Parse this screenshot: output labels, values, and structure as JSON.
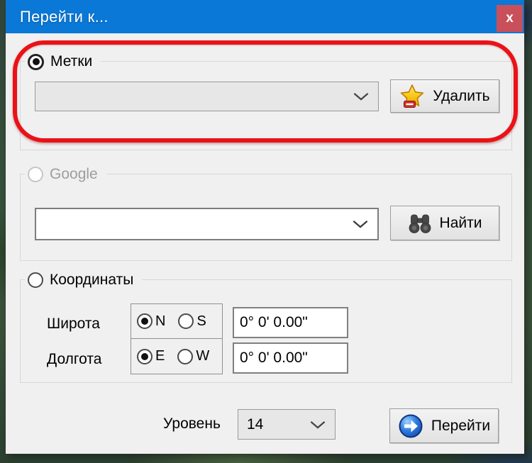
{
  "window": {
    "title": "Перейти к...",
    "close": "x"
  },
  "marks_section": {
    "radio_label": "Метки",
    "radio_selected": true,
    "combo_value": "",
    "delete_button_label": "Удалить"
  },
  "google_section": {
    "radio_label": "Google",
    "radio_selected": false,
    "combo_value": "",
    "find_button_label": "Найти"
  },
  "coords_section": {
    "radio_label": "Координаты",
    "radio_selected": false,
    "latitude": {
      "label": "Широта",
      "north": "N",
      "south": "S",
      "selected": "N",
      "value": "0° 0' 0.00\""
    },
    "longitude": {
      "label": "Долгота",
      "east": "E",
      "west": "W",
      "selected": "E",
      "value": "0° 0' 0.00\""
    }
  },
  "footer": {
    "level_label": "Уровень",
    "level_value": "14",
    "go_button_label": "Перейти"
  },
  "icons": {
    "delete": "star-minus-icon",
    "find": "binoculars-icon",
    "go": "arrow-right-circle-icon",
    "combo": "chevron-down-icon",
    "close": "close-icon"
  },
  "colors": {
    "titlebar": "#0a78d7",
    "close_button": "#c9505a",
    "dialog_bg": "#f0f0f0",
    "annotation": "#ea1218",
    "star_gold": "#f6c715",
    "badge_red": "#d03030",
    "go_blue": "#1565d8",
    "map_green": "#36503a"
  },
  "annotation": {
    "shape": "rounded-rectangle",
    "highlights": "marks section"
  }
}
